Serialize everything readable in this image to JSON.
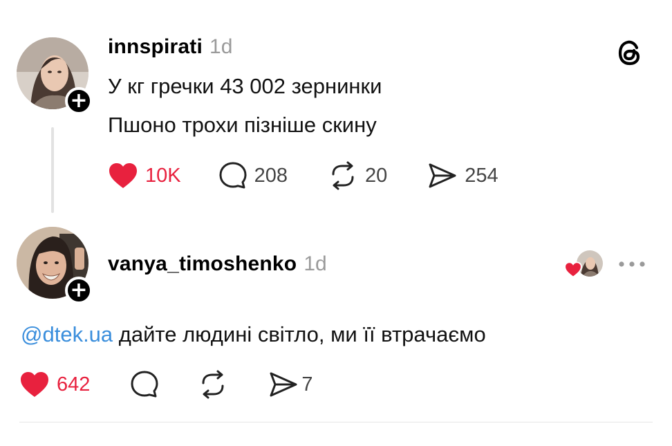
{
  "post": {
    "username": "innspirati",
    "time": "1d",
    "lines": [
      "У кг гречки 43 002 зернинки",
      "Пшоно трохи пізніше скину"
    ],
    "actions": {
      "likes": "10K",
      "comments": "208",
      "reposts": "20",
      "shares": "254"
    },
    "liked": true
  },
  "reply": {
    "username": "vanya_timoshenko",
    "time": "1d",
    "mention": "@dtek.ua",
    "text": " дайте людині світло, ми її втрачаємо",
    "actions": {
      "likes": "642",
      "shares": "7"
    },
    "liked": true
  },
  "icons": {
    "app": "threads-logo-icon",
    "like": "heart-icon",
    "comment": "comment-bubble-icon",
    "repost": "repost-icon",
    "share": "send-icon",
    "more": "more-dots-icon",
    "follow": "plus-icon"
  },
  "colors": {
    "like": "#e8213e",
    "mention": "#3a8edc",
    "muted": "#9a9a9a"
  }
}
